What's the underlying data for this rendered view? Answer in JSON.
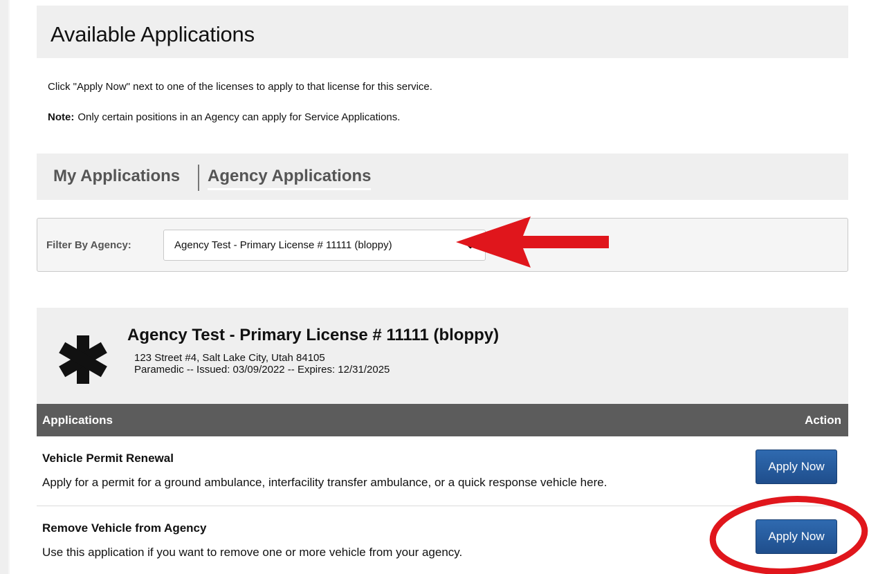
{
  "header": {
    "title": "Available Applications"
  },
  "intro": {
    "text": "Click \"Apply Now\" next to one of the licenses to apply to that license for this service.",
    "note_label": "Note:",
    "note_text": "Only certain positions in an Agency can apply for Service Applications."
  },
  "tabs": [
    {
      "label": "My Applications",
      "selected": false
    },
    {
      "label": "Agency Applications",
      "selected": true
    }
  ],
  "filter": {
    "label": "Filter By Agency:",
    "selected": "Agency Test - Primary License # 11111 (bloppy)"
  },
  "agency": {
    "icon": "star-of-life-icon",
    "name": "Agency Test - Primary License # 11111 (bloppy)",
    "address": "123 Street #4, Salt Lake City, Utah 84105",
    "license_line": "Paramedic -- Issued: 03/09/2022 -- Expires: 12/31/2025"
  },
  "table": {
    "col_applications": "Applications",
    "col_action": "Action",
    "rows": [
      {
        "title": "Vehicle Permit Renewal",
        "description": "Apply for a permit for a ground ambulance, interfacility transfer ambulance, or a quick response vehicle here.",
        "button": "Apply Now"
      },
      {
        "title": "Remove Vehicle from Agency",
        "description": "Use this application if you want to remove one or more vehicle from your agency.",
        "button": "Apply Now"
      }
    ]
  },
  "colors": {
    "accent_annotation": "#e0161c",
    "button_blue": "#1f4e8c",
    "table_header": "#5c5c5c",
    "panel_gray": "#efefef"
  }
}
